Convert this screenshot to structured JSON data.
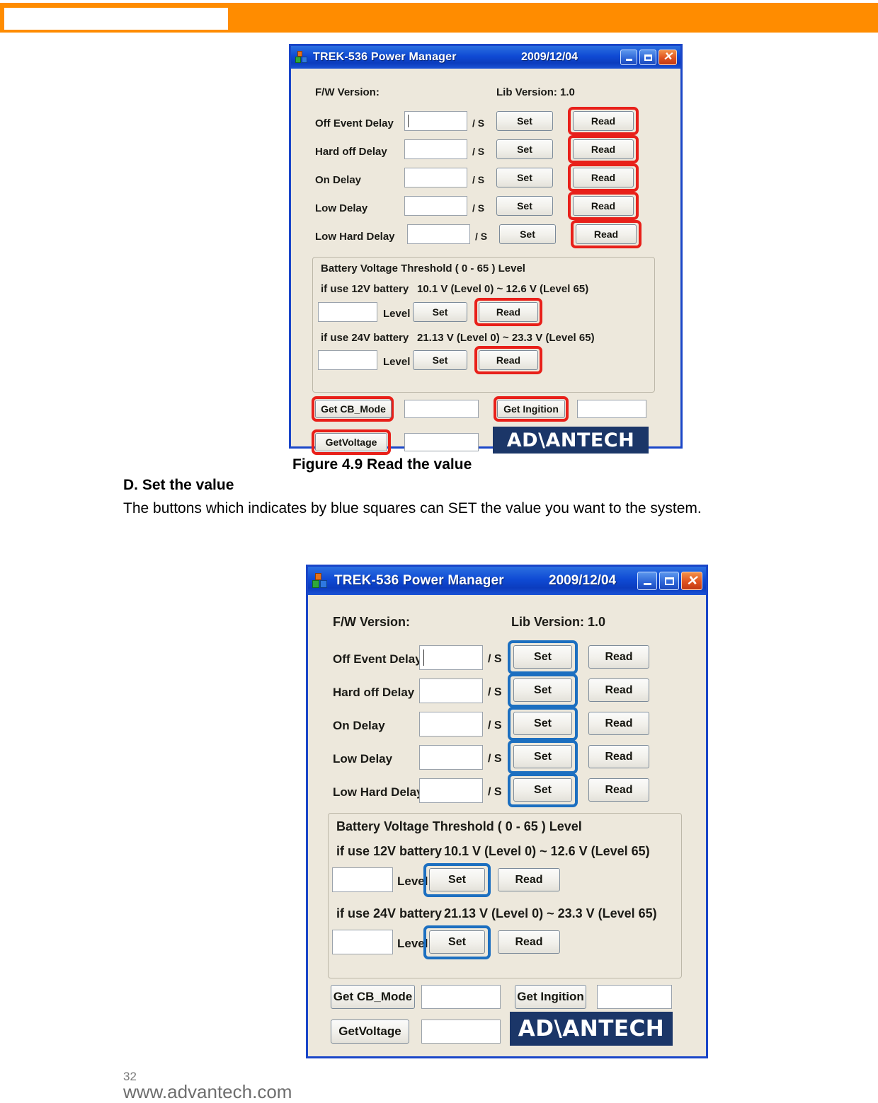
{
  "colors": {
    "banner_orange": "#FF8C00",
    "dialog_bg": "#EDE8DC",
    "dialog_border": "#1A46C8",
    "titlebar_blue": "#0F4AD4",
    "highlight_red": "#E8201A",
    "highlight_blue": "#1C6FC0",
    "logo_navy": "#1B3668"
  },
  "document": {
    "figure_caption": "Figure 4.9 Read the value",
    "section_heading": "D. Set the value",
    "body_paragraph": "The buttons which indicates by blue squares can SET the value you want to the system.",
    "page_number": "32",
    "site_url": "www.advantech.com"
  },
  "dialog": {
    "title": "TREK-536 Power Manager",
    "date": "2009/12/04",
    "window_buttons": {
      "minimize": "minimize-icon",
      "maximize": "maximize-icon",
      "close": "close-icon"
    },
    "app_icon": "trek-app-icon",
    "fw_version_label": "F/W Version:",
    "lib_version_label": "Lib Version: 1.0",
    "unit_suffix": "/ S",
    "set_label": "Set",
    "read_label": "Read",
    "level_label": "Level",
    "delay_rows": [
      {
        "label": "Off Event  Delay",
        "value": ""
      },
      {
        "label": "Hard off  Delay",
        "value": ""
      },
      {
        "label": "On  Delay",
        "value": ""
      },
      {
        "label": "Low  Delay",
        "value": ""
      },
      {
        "label": "Low Hard  Delay",
        "value": ""
      }
    ],
    "battery_group": {
      "title": "Battery Voltage Threshold  ( 0 - 65 ) Level",
      "rows": [
        {
          "label": "if use 12V battery",
          "range": "10.1 V (Level 0)  ~  12.6 V (Level 65)",
          "value": ""
        },
        {
          "label": "if use 24V battery",
          "range": "21.13 V (Level 0)  ~  23.3 V (Level 65)",
          "value": ""
        }
      ]
    },
    "bottom": {
      "get_cb_mode_label": "Get CB_Mode",
      "cb_mode_value": "",
      "get_ignition_label": "Get Ingition",
      "ignition_value": "",
      "get_voltage_label": "GetVoltage",
      "voltage_value": "",
      "brand_logo_text": "AD\\ANTECH"
    }
  }
}
